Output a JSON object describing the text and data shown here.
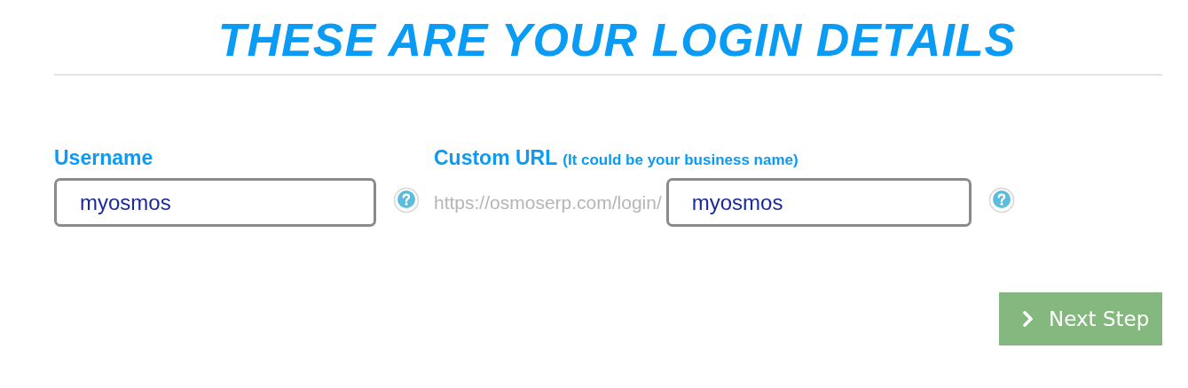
{
  "title": "THESE ARE YOUR LOGIN DETAILS",
  "username": {
    "label": "Username",
    "value": "myosmos"
  },
  "custom_url": {
    "label": "Custom URL",
    "hint": "(It could be your business name)",
    "prefix": "https://osmoserp.com/login/",
    "value": "myosmos"
  },
  "next_button": {
    "label": "Next Step"
  }
}
